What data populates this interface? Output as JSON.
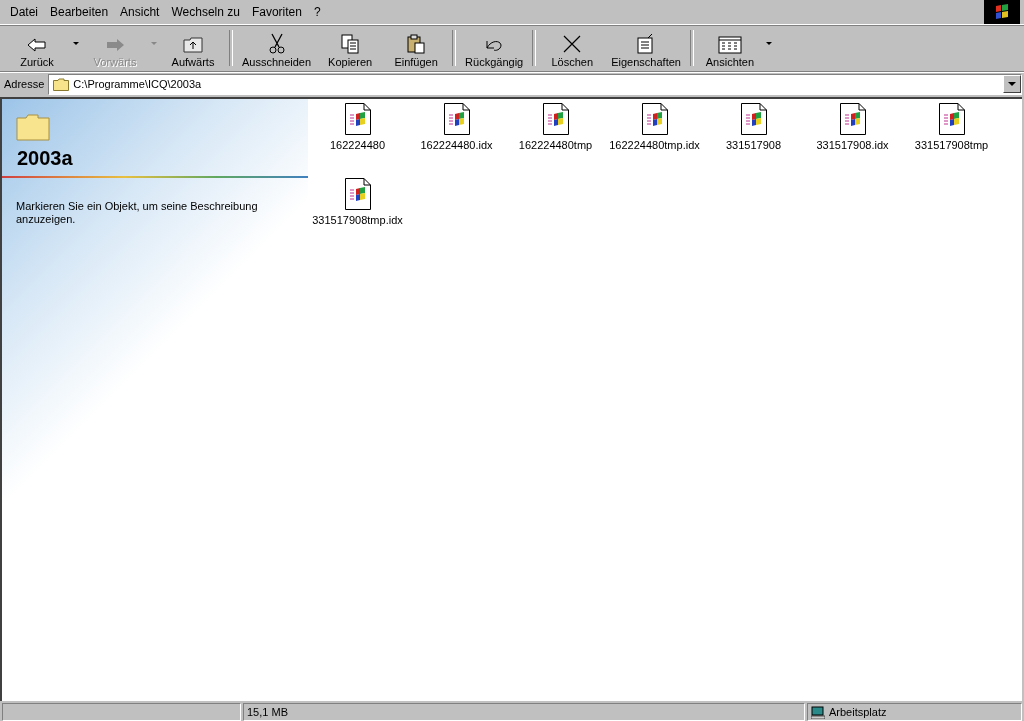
{
  "menu": [
    "Datei",
    "Bearbeiten",
    "Ansicht",
    "Wechseln zu",
    "Favoriten",
    "?"
  ],
  "toolbar": [
    [
      {
        "label": "Zurück",
        "disabled": false,
        "dropdown": true
      },
      {
        "label": "Vorwärts",
        "disabled": true,
        "dropdown": true
      },
      {
        "label": "Aufwärts",
        "disabled": false,
        "dropdown": false
      }
    ],
    [
      {
        "label": "Ausschneiden",
        "disabled": false,
        "dropdown": false
      },
      {
        "label": "Kopieren",
        "disabled": false,
        "dropdown": false
      },
      {
        "label": "Einfügen",
        "disabled": false,
        "dropdown": false
      }
    ],
    [
      {
        "label": "Rückgängig",
        "disabled": false,
        "dropdown": false
      }
    ],
    [
      {
        "label": "Löschen",
        "disabled": false,
        "dropdown": false
      },
      {
        "label": "Eigenschaften",
        "disabled": false,
        "dropdown": false
      }
    ],
    [
      {
        "label": "Ansichten",
        "disabled": false,
        "dropdown": true
      }
    ]
  ],
  "address": {
    "label": "Adresse",
    "value": "C:\\Programme\\ICQ\\2003a"
  },
  "info_panel": {
    "title": "2003a",
    "description": "Markieren Sie ein Objekt, um seine Beschreibung anzuzeigen."
  },
  "files": [
    {
      "name": "162224480",
      "selected": false
    },
    {
      "name": "162224480.idx",
      "selected": false
    },
    {
      "name": "162224480tmp",
      "selected": false
    },
    {
      "name": "162224480tmp.idx",
      "selected": false
    },
    {
      "name": "331517908",
      "selected": false
    },
    {
      "name": "331517908.idx",
      "selected": false
    },
    {
      "name": "331517908tmp",
      "selected": false
    },
    {
      "name": "331517908tmp.idx",
      "selected": false
    }
  ],
  "status_bar": {
    "size": "15,1 MB",
    "zone": "Arbeitsplatz"
  }
}
